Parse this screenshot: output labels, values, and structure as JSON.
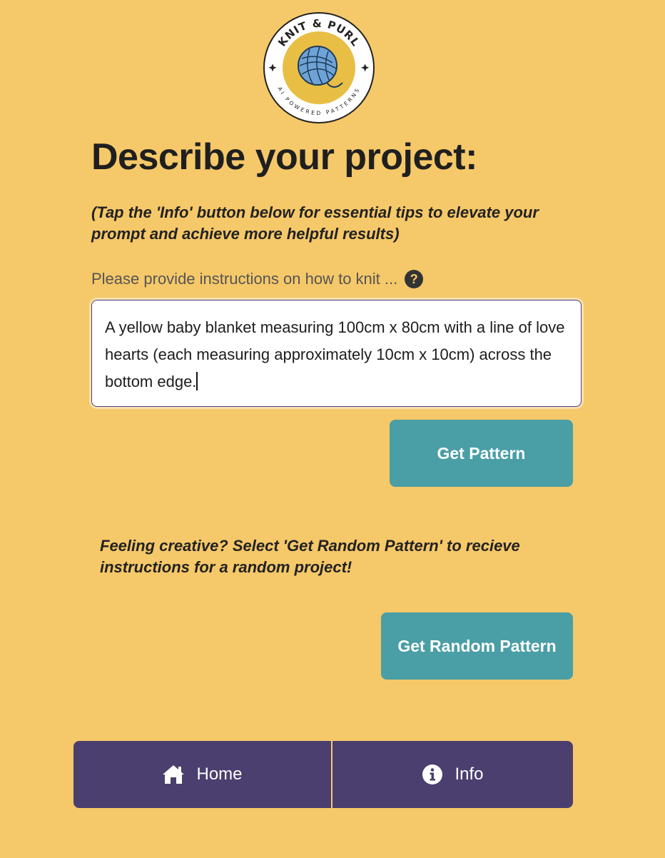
{
  "logo": {
    "top_text": "KNIT & PURL",
    "bottom_text": "AI POWERED PATTERNS",
    "icon": "yarn-ball-icon"
  },
  "page": {
    "title": "Describe your project:",
    "tip": "(Tap the 'Info' button below for essential tips to elevate your prompt and achieve more helpful results)"
  },
  "prompt": {
    "label": "Please provide instructions on how to knit ...",
    "help_icon": "?",
    "value": "A yellow baby blanket measuring 100cm x 80cm with a line of love hearts (each measuring approximately 10cm x 10cm) across the bottom edge."
  },
  "buttons": {
    "get_pattern": "Get Pattern",
    "creative_text": "Feeling creative? Select 'Get Random Pattern' to recieve instructions for a random project!",
    "get_random_pattern": "Get Random Pattern"
  },
  "nav": {
    "home_label": "Home",
    "home_icon": "home-icon",
    "info_label": "Info",
    "info_icon": "info-icon"
  },
  "colors": {
    "background": "#f5c869",
    "accent_teal": "#4a9ea6",
    "nav_purple": "#4a3f6e",
    "logo_yellow": "#e9be45",
    "yarn_blue": "#6fa3d6"
  }
}
